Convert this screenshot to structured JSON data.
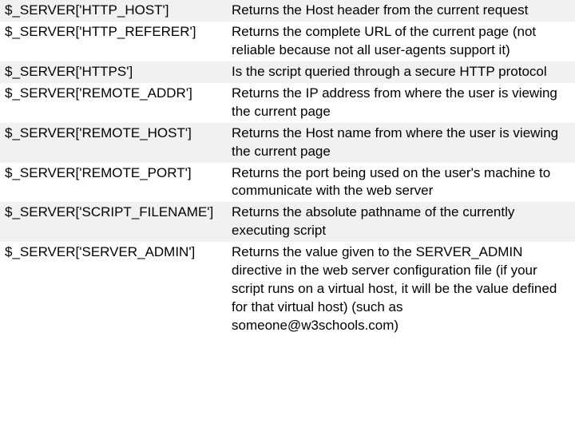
{
  "rows": [
    {
      "key": "$_SERVER['HTTP_HOST']",
      "desc": "Returns the Host header from the current request"
    },
    {
      "key": "$_SERVER['HTTP_REFERER']",
      "desc": "Returns the complete URL of the current page (not reliable because not all user-agents support it)"
    },
    {
      "key": "$_SERVER['HTTPS']",
      "desc": "Is the script queried through a secure HTTP protocol"
    },
    {
      "key": "$_SERVER['REMOTE_ADDR']",
      "desc": "Returns the IP address from where the user is viewing the current page"
    },
    {
      "key": "$_SERVER['REMOTE_HOST']",
      "desc": "Returns the Host name from where the user is viewing the current page"
    },
    {
      "key": "$_SERVER['REMOTE_PORT']",
      "desc": "Returns the port being used on the user's machine to communicate with the web server"
    },
    {
      "key": "$_SERVER['SCRIPT_FILENAME']",
      "desc": "Returns the absolute pathname of the currently executing script"
    },
    {
      "key": "$_SERVER['SERVER_ADMIN']",
      "desc": "Returns the value given to the SERVER_ADMIN directive in the web server configuration file (if your script runs on a virtual host, it will be the value defined for that virtual host) (such as someone@w3schools.com)"
    }
  ]
}
